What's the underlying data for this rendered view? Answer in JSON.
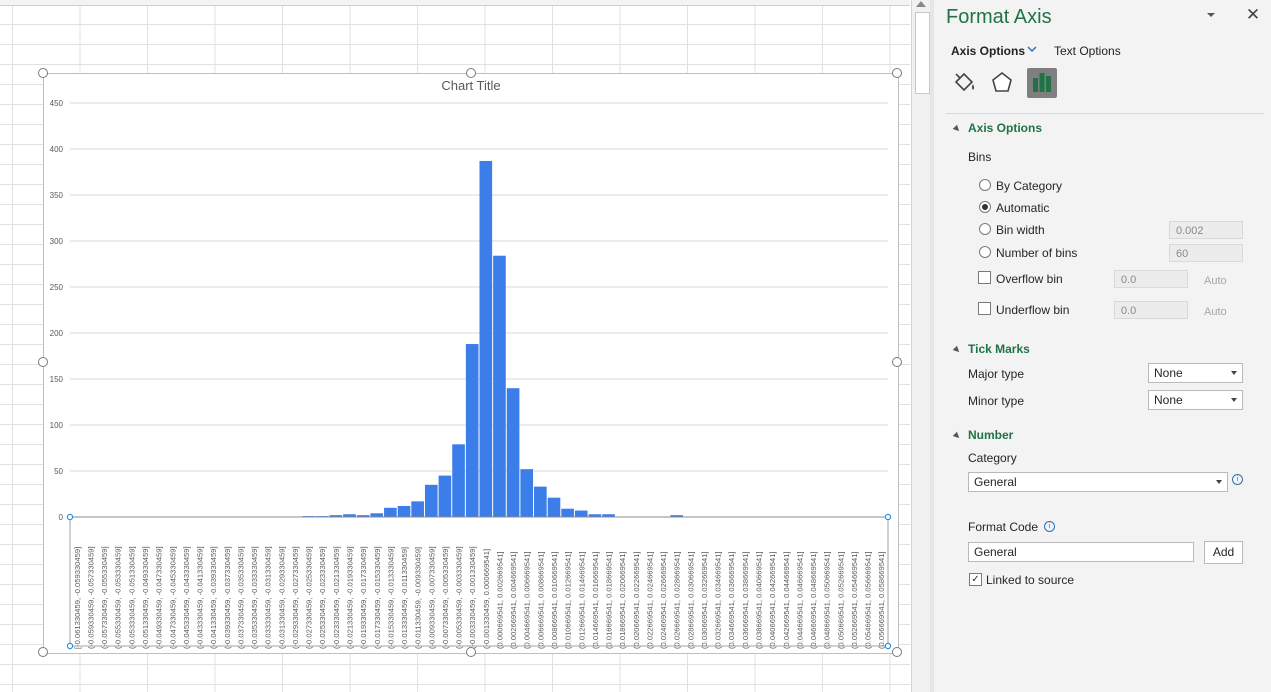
{
  "chart_data": {
    "type": "bar",
    "title": "Chart Title",
    "ylim": [
      0,
      450
    ],
    "y_ticks": [
      "450",
      "400",
      "350",
      "300",
      "250",
      "200",
      "150",
      "100",
      "50",
      "0"
    ],
    "grid": true,
    "color": "#3b7de9",
    "categories": [
      "[-0.061330459, -0.059330459]",
      "(-0.059330459, -0.057330459]",
      "(-0.057330459, -0.055330459]",
      "(-0.055330459, -0.053330459]",
      "(-0.053330459, -0.051330459]",
      "(-0.051330459, -0.049330459]",
      "(-0.049330459, -0.047330459]",
      "(-0.047330459, -0.045330459]",
      "(-0.045330459, -0.043330459]",
      "(-0.043330459, -0.041330459]",
      "(-0.041330459, -0.039330459]",
      "(-0.039330459, -0.037330459]",
      "(-0.037330459, -0.035330459]",
      "(-0.035330459, -0.033330459]",
      "(-0.033330459, -0.031330459]",
      "(-0.031330459, -0.029330459]",
      "(-0.029330459, -0.027330459]",
      "(-0.027330459, -0.025330459]",
      "(-0.025330459, -0.023330459]",
      "(-0.023330459, -0.021330459]",
      "(-0.021330459, -0.019330459]",
      "(-0.019330459, -0.017330459]",
      "(-0.017330459, -0.015330459]",
      "(-0.015330459, -0.013330459]",
      "(-0.013330459, -0.011330459]",
      "(-0.011330459, -0.009330459]",
      "(-0.009330459, -0.007330459]",
      "(-0.007330459, -0.005330459]",
      "(-0.005330459, -0.003330459]",
      "(-0.003330459, -0.001330459]",
      "(-0.001330459, 0.000669541]",
      "(0.000669541, 0.002669541]",
      "(0.002669541, 0.004669541]",
      "(0.004669541, 0.006669541]",
      "(0.006669541, 0.008669541]",
      "(0.008669541, 0.010669541]",
      "(0.010669541, 0.012669541]",
      "(0.012669541, 0.014669541]",
      "(0.014669541, 0.016669541]",
      "(0.016669541, 0.018669541]",
      "(0.018669541, 0.020669541]",
      "(0.020669541, 0.022669541]",
      "(0.022669541, 0.024669541]",
      "(0.024669541, 0.026669541]",
      "(0.026669541, 0.028669541]",
      "(0.028669541, 0.030669541]",
      "(0.030669541, 0.032669541]",
      "(0.032669541, 0.034669541]",
      "(0.034669541, 0.036669541]",
      "(0.036669541, 0.038669541]",
      "(0.038669541, 0.040669541]",
      "(0.040669541, 0.042669541]",
      "(0.042669541, 0.044669541]",
      "(0.044669541, 0.046669541]",
      "(0.046669541, 0.048669541]",
      "(0.048669541, 0.050669541]",
      "(0.050669541, 0.052669541]",
      "(0.052669541, 0.054669541]",
      "(0.054669541, 0.056669541]",
      "(0.056669541, 0.058669541]"
    ],
    "values": [
      0,
      0,
      0,
      0,
      0,
      0,
      0,
      0,
      0,
      0,
      0,
      0,
      0,
      0,
      0,
      0,
      0,
      1,
      1,
      2,
      3,
      2,
      4,
      10,
      12,
      17,
      35,
      45,
      79,
      188,
      387,
      284,
      140,
      52,
      33,
      21,
      9,
      7,
      3,
      3,
      0,
      0,
      0,
      0,
      2,
      0,
      0,
      0,
      0,
      0,
      0,
      0,
      0,
      0,
      0,
      0,
      0,
      0,
      0,
      0
    ]
  },
  "panel": {
    "title": "Format Axis",
    "tab_axis": "Axis Options",
    "tab_text": "Text Options",
    "icons": {
      "fill": "fill-line-icon",
      "effects": "effects-icon",
      "axis": "axis-options-icon"
    },
    "axis_options": {
      "heading": "Axis Options",
      "bins_label": "Bins",
      "by_category": "By Category",
      "automatic": "Automatic",
      "bin_width": "Bin width",
      "bin_width_value": "0.002",
      "number_of_bins": "Number of bins",
      "number_of_bins_value": "60",
      "overflow_bin": "Overflow bin",
      "overflow_value": "0.0",
      "underflow_bin": "Underflow bin",
      "underflow_value": "0.0",
      "auto": "Auto",
      "selected": "automatic"
    },
    "tick_marks": {
      "heading": "Tick Marks",
      "major_label": "Major type",
      "major_value": "None",
      "minor_label": "Minor type",
      "minor_value": "None"
    },
    "number": {
      "heading": "Number",
      "category_label": "Category",
      "category_value": "General",
      "format_code_label": "Format Code",
      "format_code_value": "General",
      "add_label": "Add",
      "linked_label": "Linked to source",
      "linked_checked": true
    }
  }
}
